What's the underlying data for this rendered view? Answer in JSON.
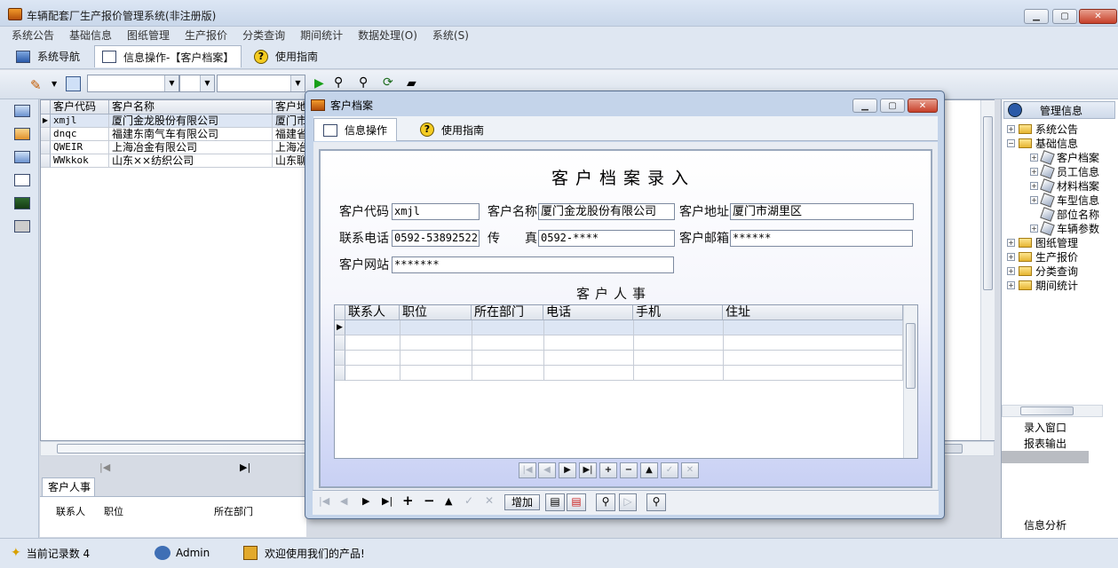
{
  "app": {
    "title": "车辆配套厂生产报价管理系统(非注册版)"
  },
  "menu": [
    "系统公告",
    "基础信息",
    "图纸管理",
    "生产报价",
    "分类查询",
    "期间统计",
    "数据处理(O)",
    "系统(S)"
  ],
  "nav_tabs": [
    {
      "label": "系统导航"
    },
    {
      "label": "信息操作-【客户档案】"
    },
    {
      "label": "使用指南"
    }
  ],
  "main_grid": {
    "columns": [
      "客户代码",
      "客户名称",
      "客户地"
    ],
    "rows": [
      {
        "code": "xmjl",
        "name": "厦门金龙股份有限公司",
        "addr": "厦门市"
      },
      {
        "code": "dnqc",
        "name": "福建东南气车有限公司",
        "addr": "福建省"
      },
      {
        "code": "QWEIR",
        "name": "上海冶金有限公司",
        "addr": "上海冶"
      },
      {
        "code": "WWkkok",
        "name": "山东××纺织公司",
        "addr": "山东聊"
      }
    ]
  },
  "bottom_tab": {
    "label": "客户人事",
    "columns": [
      "联系人",
      "职位",
      "所在部门"
    ]
  },
  "tree": {
    "header": "管理信息",
    "items": [
      {
        "label": "系统公告",
        "level": 0,
        "kind": "folder",
        "toggle": "+"
      },
      {
        "label": "基础信息",
        "level": 0,
        "kind": "folder",
        "toggle": "−"
      },
      {
        "label": "客户档案",
        "level": 1,
        "kind": "leaf",
        "toggle": "+"
      },
      {
        "label": "员工信息",
        "level": 1,
        "kind": "leaf",
        "toggle": "+"
      },
      {
        "label": "材料档案",
        "level": 1,
        "kind": "leaf",
        "toggle": "+"
      },
      {
        "label": "车型信息",
        "level": 1,
        "kind": "leaf",
        "toggle": "+"
      },
      {
        "label": "部位名称",
        "level": 1,
        "kind": "leaf",
        "toggle": ""
      },
      {
        "label": "车辆参数",
        "level": 1,
        "kind": "leaf",
        "toggle": "+"
      },
      {
        "label": "图纸管理",
        "level": 0,
        "kind": "folder",
        "toggle": "+"
      },
      {
        "label": "生产报价",
        "level": 0,
        "kind": "folder",
        "toggle": "+"
      },
      {
        "label": "分类查询",
        "level": 0,
        "kind": "folder",
        "toggle": "+"
      },
      {
        "label": "期间统计",
        "level": 0,
        "kind": "folder",
        "toggle": "+"
      }
    ],
    "buttons": [
      "录入窗口",
      "报表输出"
    ],
    "bottom_label": "信息分析"
  },
  "status": {
    "record_count": "当前记录数 4",
    "user": "Admin",
    "welcome": "欢迎使用我们的产品!"
  },
  "dialog": {
    "title": "客户档案",
    "tabs": [
      "信息操作",
      "使用指南"
    ],
    "heading": "客户档案录入",
    "fields": {
      "code_label": "客户代码",
      "code": "xmjl",
      "name_label": "客户名称",
      "name": "厦门金龙股份有限公司",
      "addr_label": "客户地址",
      "addr": "厦门市湖里区",
      "phone_label": "联系电话",
      "phone": "0592-53892522",
      "fax_label_a": "传",
      "fax_label_b": "真",
      "fax": "0592-****",
      "email_label": "客户邮箱",
      "email": "******",
      "web_label": "客户网站",
      "web": "*******"
    },
    "subheading": "客户人事",
    "staff_columns": [
      "联系人",
      "职位",
      "所在部门",
      "电话",
      "手机",
      "住址"
    ],
    "add_button": "增加"
  }
}
